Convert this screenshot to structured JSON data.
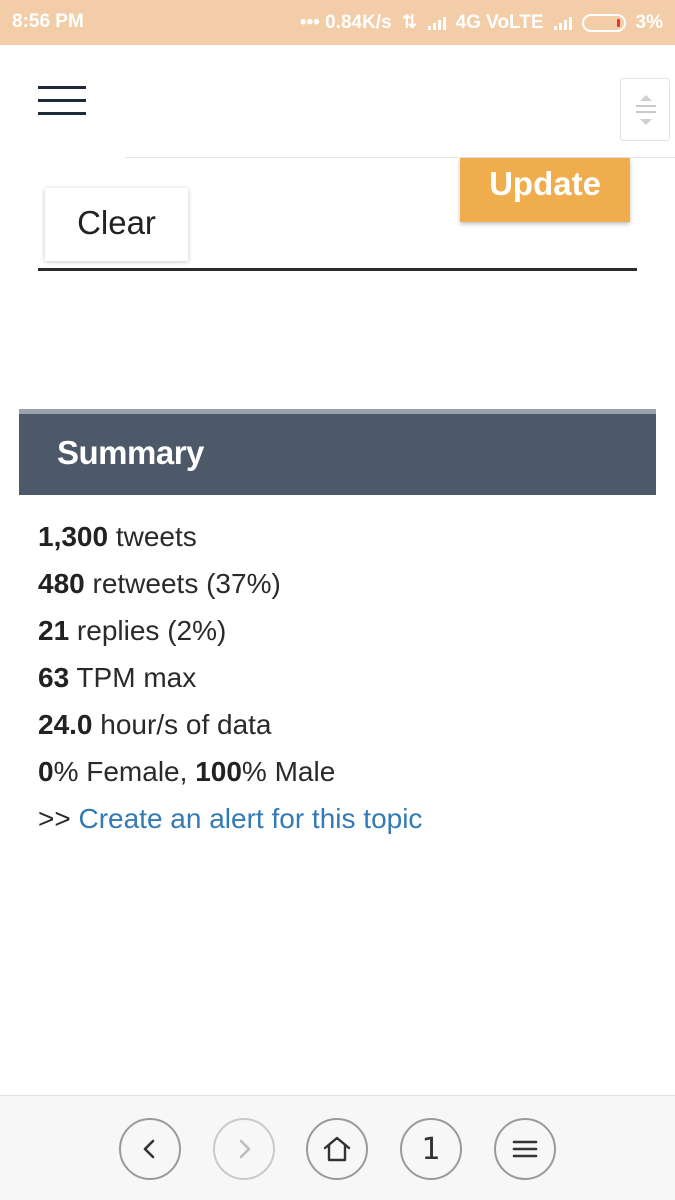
{
  "status_bar": {
    "time": "8:56 PM",
    "network_speed": "••• 0.84K/s",
    "network_type": "4G VoLTE",
    "battery_percent": "3%"
  },
  "header": {
    "menu_icon": "hamburger-menu-icon",
    "scroll_icon": "scroll-handle-icon"
  },
  "controls": {
    "update_label": "Update",
    "clear_label": "Clear"
  },
  "summary": {
    "title": "Summary",
    "tweets_value": "1,300",
    "tweets_label": " tweets",
    "retweets_value": "480",
    "retweets_label": " retweets (37%)",
    "replies_value": "21",
    "replies_label": " replies (2%)",
    "tpm_value": "63",
    "tpm_label": " TPM max",
    "hours_value": "24.0",
    "hours_label": " hour/s of data",
    "female_value": "0",
    "female_label": "% Female, ",
    "male_value": "100",
    "male_label": "% Male",
    "alert_prefix": ">> ",
    "alert_link": "Create an alert for this topic"
  },
  "bottom_nav": {
    "back_icon": "chevron-left-icon",
    "forward_icon": "chevron-right-icon",
    "home_icon": "home-icon",
    "tab_count": "1",
    "menu_icon": "menu-icon"
  },
  "colors": {
    "status_bar_bg": "#f2cda8",
    "update_button": "#f0ad4e",
    "summary_header_bg": "#4d5868",
    "link": "#337ab7"
  }
}
